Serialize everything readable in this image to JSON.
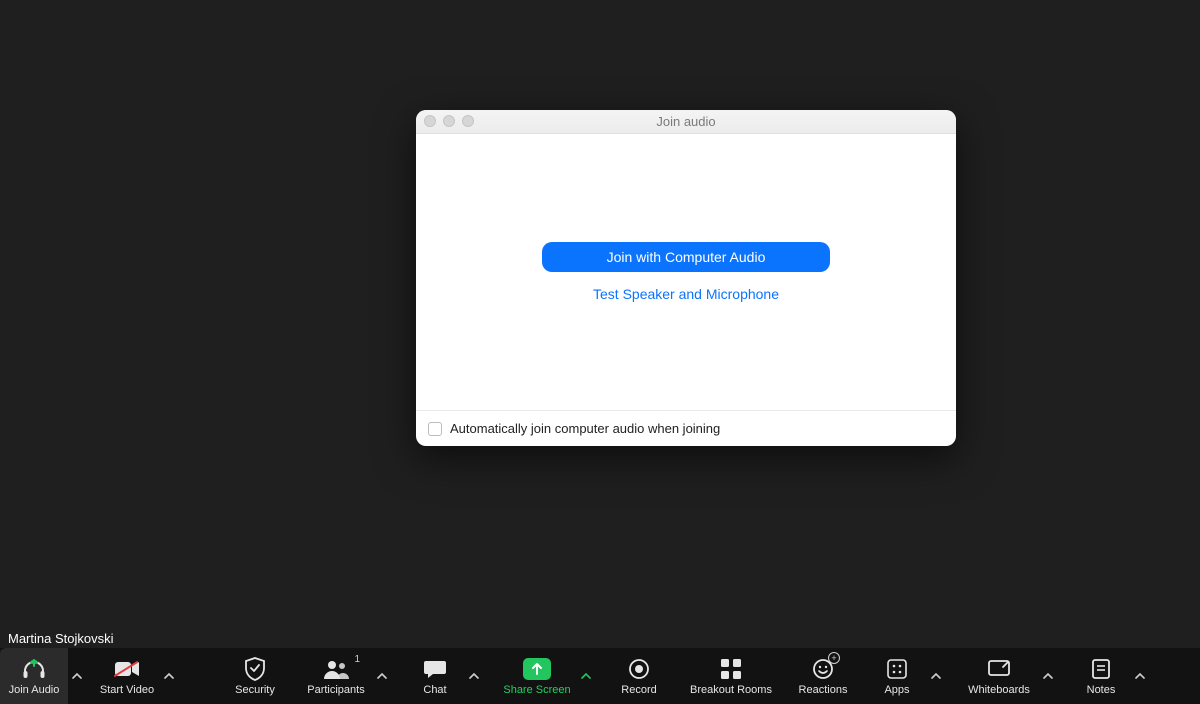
{
  "participant_name": "Martina Stojkovski",
  "modal": {
    "title": "Join audio",
    "primary_button": "Join with Computer Audio",
    "secondary_link": "Test Speaker and Microphone",
    "auto_join_label": "Automatically join computer audio when joining"
  },
  "toolbar": {
    "join_audio": "Join Audio",
    "start_video": "Start Video",
    "security": "Security",
    "participants": "Participants",
    "participants_count": "1",
    "chat": "Chat",
    "share_screen": "Share Screen",
    "record": "Record",
    "breakout_rooms": "Breakout Rooms",
    "reactions": "Reactions",
    "apps": "Apps",
    "whiteboards": "Whiteboards",
    "notes": "Notes"
  },
  "colors": {
    "accent_green": "#23c55e",
    "accent_blue": "#0b74ff",
    "danger_red": "#e23b3b"
  }
}
